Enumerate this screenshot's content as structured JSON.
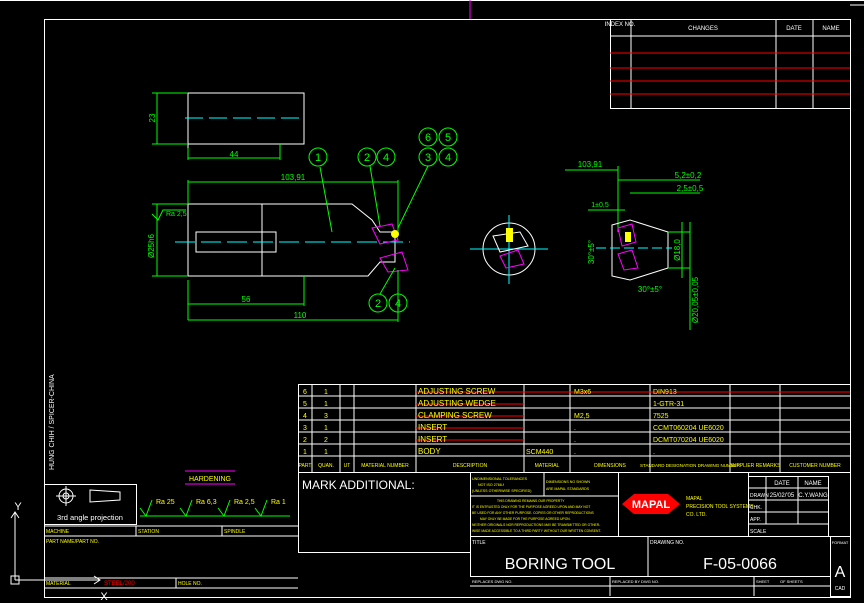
{
  "colors": {
    "bg": "#000000",
    "frame": "#ffffff",
    "dim": "#00ff00",
    "text": "#ffff00",
    "red": "#ff0000",
    "cyan": "#00ffff",
    "magenta": "#ff00ff"
  },
  "revision": {
    "headers": [
      "INDEX NO.",
      "CHANGES",
      "DATE",
      "NAME"
    ]
  },
  "dims": {
    "d23": "23",
    "d44": "44",
    "d10391a": "103,91",
    "d10391b": "103,91",
    "ra25": "Ra 2,5",
    "d25h6": "Ø25h6",
    "d56": "56",
    "d110": "110",
    "d52": "5,2±0,2",
    "d25": "2,5±0,5",
    "d1": "1±0,5",
    "a30a": "30°±5°",
    "a30b": "30°±5°",
    "d18": "Ø18,0",
    "d2005": "Ø20,05±0,05"
  },
  "balloons": [
    "1",
    "2",
    "4",
    "6",
    "5",
    "3",
    "4",
    "2",
    "4"
  ],
  "side_text": "HUNG CHIH / SPICER-CHINA",
  "parts": [
    {
      "pos": "6",
      "qty": "1",
      "name": "ADJUSTING SCREW",
      "dims": "M3x6",
      "std": "DIN913"
    },
    {
      "pos": "5",
      "qty": "1",
      "name": "ADJUSTING WEDGE",
      "dims": "",
      "std": "1-GTR-31"
    },
    {
      "pos": "4",
      "qty": "3",
      "name": "CLAMPING SCREW",
      "dims": "M2,5",
      "std": "7525"
    },
    {
      "pos": "3",
      "qty": "1",
      "name": "INSERT",
      "dims": ".",
      "std": "CCMT060204 UE6020"
    },
    {
      "pos": "2",
      "qty": "2",
      "name": "INSERT",
      "dims": ".",
      "std": "DCMT070204 UE6020"
    },
    {
      "pos": "1",
      "qty": "1",
      "name": "BODY",
      "material": "SCM440",
      "dims": ".",
      "std": "."
    }
  ],
  "parts_headers": [
    "PART",
    "QUAN.",
    "UT",
    "MATERIAL NUMBER",
    "DESCRIPTION",
    "MATERIAL",
    "DIMENSIONS",
    "STANDARD DESIGNATION DRAWING NUMBER",
    "SUPPLIER REMARKS",
    "CUSTOMER NUMBER"
  ],
  "mark_additional": "MARK ADDITIONAL:",
  "hardening": "HARDENING",
  "projection": "3rd angle projection",
  "surfaces": [
    "Ra 25",
    "Ra 6,3",
    "Ra 2,5",
    "Ra 1"
  ],
  "left_labels": {
    "machine": "MACHINE",
    "station": "STATION",
    "spindle": "SPINDLE",
    "part_name": "PART NAME/PART NO.",
    "material": "MATERIAL",
    "material_val": "STEEL/200",
    "hole": "HOLE NO."
  },
  "tolerance_lines": [
    "UNDIMENSIONAL TOLERANCES",
    "NOT ISO 2768-f",
    "(UNLESS OTHERWISE SPECIFIED)",
    "DIMENSIONS NO SHOWN",
    "ARE MAPAL STANDARDS",
    "THIS DRAWING REMAINS OUR PROPERTY",
    "IT IS ENTRUSTED ONLY FOR THE PURPOSE AGREED UPON AND MAY NOT",
    "BE USED FOR ANY OTHER PURPOSE. COPIES OR OTHER REPRODUCTIONS",
    "MAY ONLY BE MADE FOR THE PURPOSE AGREED UPON.",
    "NEITHER ORIGINALS NOR REPRODUCTIONS MAY BE TRANSMITTED OR OTHER-",
    "WISE MADE ACCESSIBLE TO A THIRD PARTY WITHOUT OUR WRITTEN CONSENT."
  ],
  "logo": "MAPAL",
  "company": [
    "MAPAL",
    "PRECISION TOOL SYSTEMS",
    "CO. LTD."
  ],
  "sign": {
    "date_h": "DATE",
    "name_h": "NAME",
    "drawn": "DRAWN",
    "date": "25/02/'05",
    "name": "C.Y.WANG",
    "chk": "CHK.",
    "app": "APP.",
    "scale": "SCALE"
  },
  "title_label": "TITLE",
  "title": "BORING TOOL",
  "drawing_no_label": "DRAWING NO.",
  "drawing_no": "F-05-0066",
  "format_label": "FORMAT",
  "format": "A",
  "cad": "CAD",
  "replaces": "REPLACES DWG NO.",
  "replaced_by": "REPLACED BY DWG NO.",
  "sheet": "SHEET",
  "of": "OF SHEETS",
  "axis": {
    "y": "Y",
    "x": "X"
  }
}
